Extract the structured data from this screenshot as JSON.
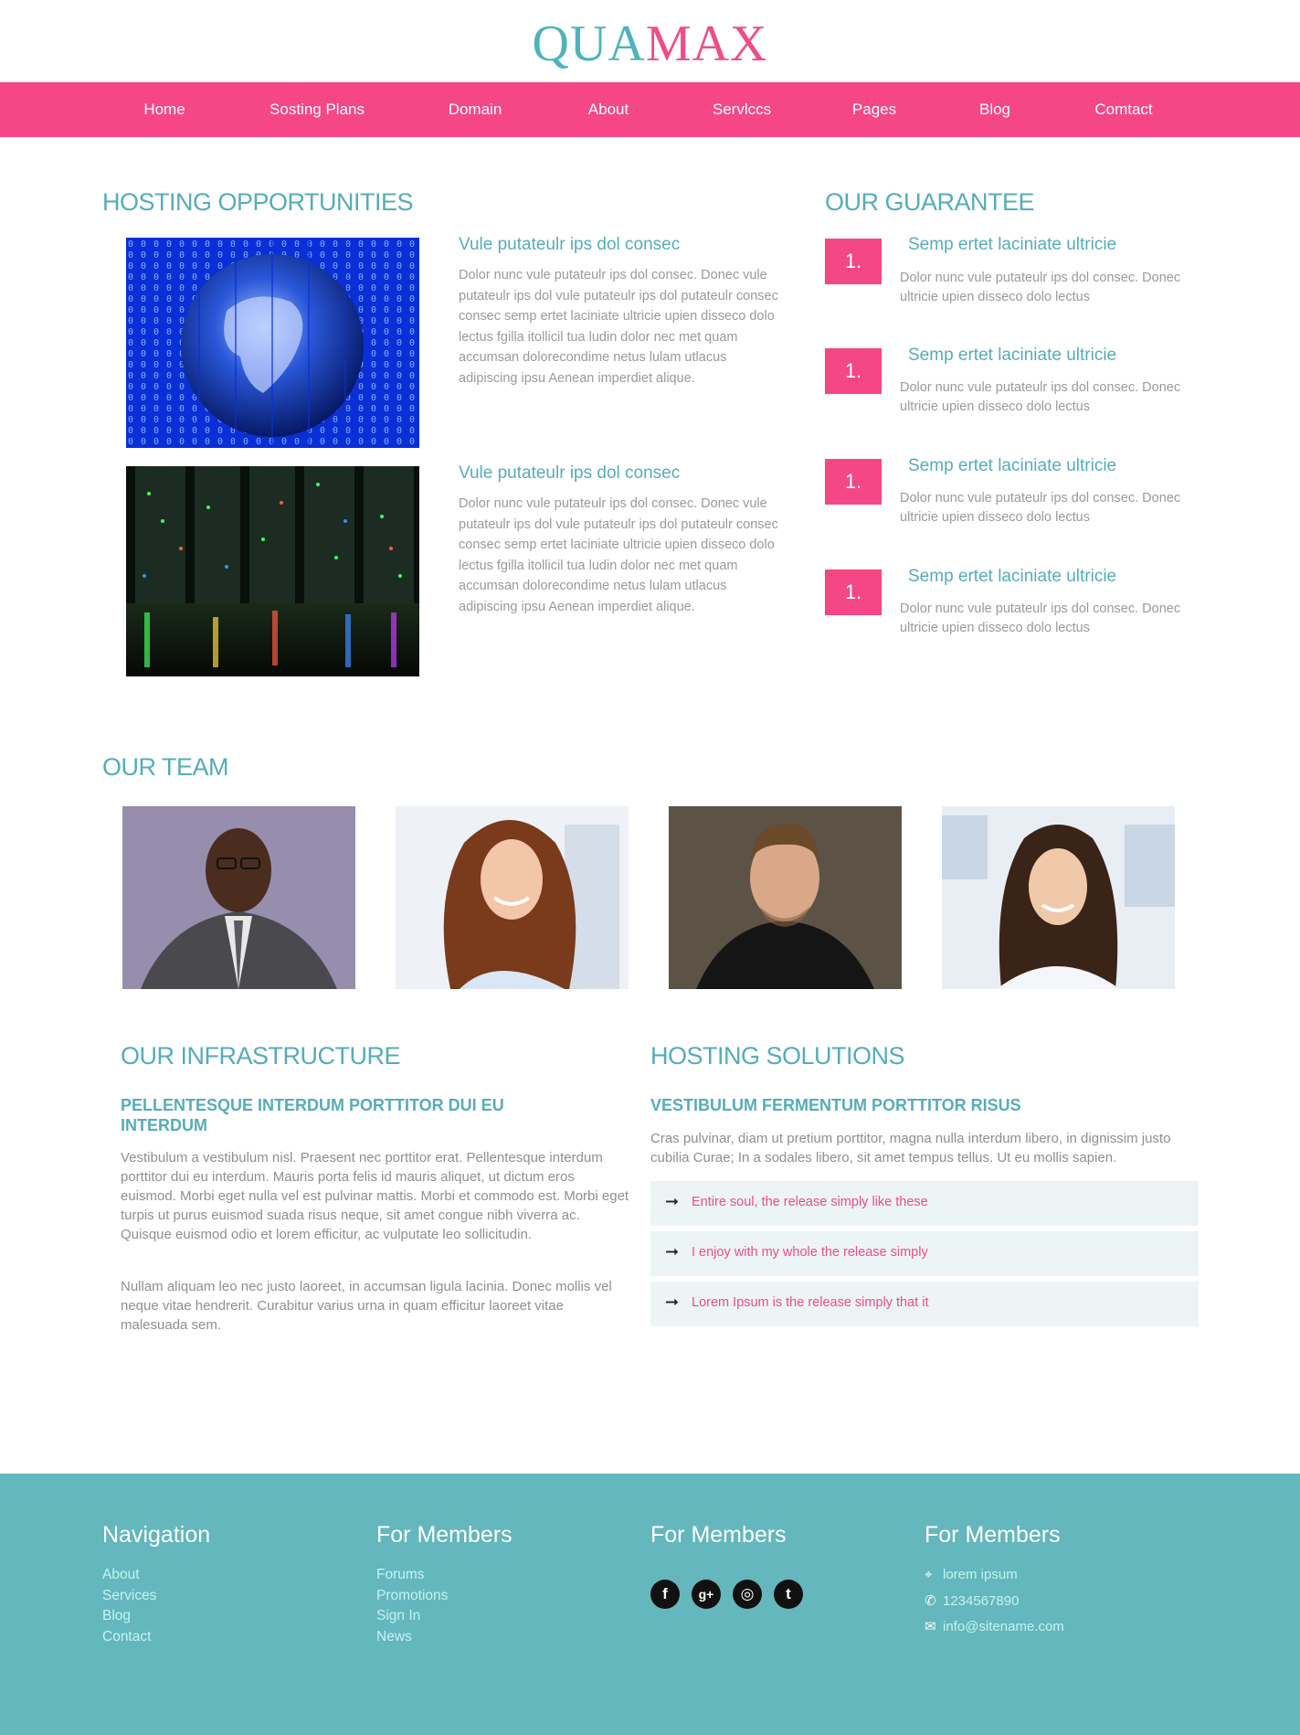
{
  "brand": {
    "part1": "QUA",
    "part2": "MAX",
    "color1": "#4fb3bc",
    "color2": "#ef4c8a"
  },
  "nav": [
    "Home",
    "Sosting Plans",
    "Domain",
    "About",
    "Servlccs",
    "Pages",
    "Blog",
    "Comtact"
  ],
  "opportunities": {
    "heading": "HOSTING OPPORTUNITIES",
    "items": [
      {
        "title": "Vule putateulr ips dol consec",
        "image": "globe-binary-image",
        "text": "Dolor nunc vule putateulr ips dol consec. Donec vule putateulr ips dol vule putateulr ips dol putateulr consec consec semp ertet laciniate ultricie upien disseco dolo lectus fgilla itollicil tua ludin dolor nec met quam accumsan dolorecondime netus lulam utlacus adipiscing ipsu Aenean imperdiet alique."
      },
      {
        "title": "Vule putateulr ips dol consec",
        "image": "server-room-image",
        "text": "Dolor nunc vule putateulr ips dol consec. Donec vule putateulr ips dol vule putateulr ips dol putateulr consec consec semp ertet laciniate ultricie upien disseco dolo lectus fgilla itollicil tua ludin dolor nec met quam accumsan dolorecondime netus lulam utlacus adipiscing ipsu Aenean imperdiet alique."
      }
    ]
  },
  "guarantee": {
    "heading": "OUR GUARANTEE",
    "items": [
      {
        "badge": "1.",
        "title": "Semp ertet laciniate ultricie",
        "text": "Dolor nunc vule putateulr ips dol consec. Donec ultricie upien disseco dolo lectus"
      },
      {
        "badge": "1.",
        "title": "Semp ertet laciniate ultricie",
        "text": "Dolor nunc vule putateulr ips dol consec. Donec ultricie upien disseco dolo lectus"
      },
      {
        "badge": "1.",
        "title": "Semp ertet laciniate ultricie",
        "text": "Dolor nunc vule putateulr ips dol consec. Donec ultricie upien disseco dolo lectus"
      },
      {
        "badge": "1.",
        "title": "Semp ertet laciniate ultricie",
        "text": "Dolor nunc vule putateulr ips dol consec. Donec ultricie upien disseco dolo lectus"
      }
    ]
  },
  "team": {
    "heading": "OUR TEAM",
    "members": [
      "man-in-suit-photo",
      "smiling-woman-photo",
      "young-man-photo",
      "woman-portrait-photo"
    ]
  },
  "infrastructure": {
    "heading": "OUR INFRASTRUCTURE",
    "subheading": "PELLENTESQUE INTERDUM PORTTITOR DUI EU INTERDUM",
    "p1": "Vestibulum a vestibulum nisl. Praesent nec porttitor erat. Pellentesque interdum porttitor dui eu interdum. Mauris porta felis id mauris aliquet, ut dictum eros euismod. Morbi eget nulla vel est pulvinar mattis. Morbi et commodo est. Morbi eget turpis ut purus euismod suada risus neque, sit amet congue nibh viverra ac. Quisque euismod odio et lorem efficitur, ac vulputate leo sollicitudin.",
    "p2": "Nullam aliquam leo nec justo laoreet, in accumsan ligula lacinia. Donec mollis vel neque vitae hendrerit. Curabitur varius urna in quam efficitur laoreet vitae malesuada sem."
  },
  "solutions": {
    "heading": "HOSTING SOLUTIONS",
    "subheading": "VESTIBULUM FERMENTUM PORTTITOR RISUS",
    "text": "Cras pulvinar, diam ut pretium porttitor, magna nulla interdum libero, in dignissim justo cubilia Curae; In a sodales libero, sit amet tempus tellus. Ut eu mollis sapien.",
    "items": [
      "Entire soul, the release simply like these",
      "I enjoy with my whole the release simply",
      "Lorem Ipsum is the release simply that it"
    ]
  },
  "footer": {
    "col1": {
      "heading": "Navigation",
      "links": [
        "About",
        "Services",
        "Blog",
        "Contact"
      ]
    },
    "col2": {
      "heading": "For Members",
      "links": [
        "Forums",
        "Promotions",
        "Sign In",
        "News"
      ]
    },
    "col3": {
      "heading": "For Members",
      "social": [
        {
          "icon": "facebook-icon",
          "glyph": "f"
        },
        {
          "icon": "google-plus-icon",
          "glyph": "g+"
        },
        {
          "icon": "instagram-icon",
          "glyph": "◎"
        },
        {
          "icon": "twitter-icon",
          "glyph": "t"
        }
      ]
    },
    "col4": {
      "heading": "For Members",
      "address": "lorem ipsum",
      "phone": "1234567890",
      "email": "info@sitename.com"
    }
  }
}
